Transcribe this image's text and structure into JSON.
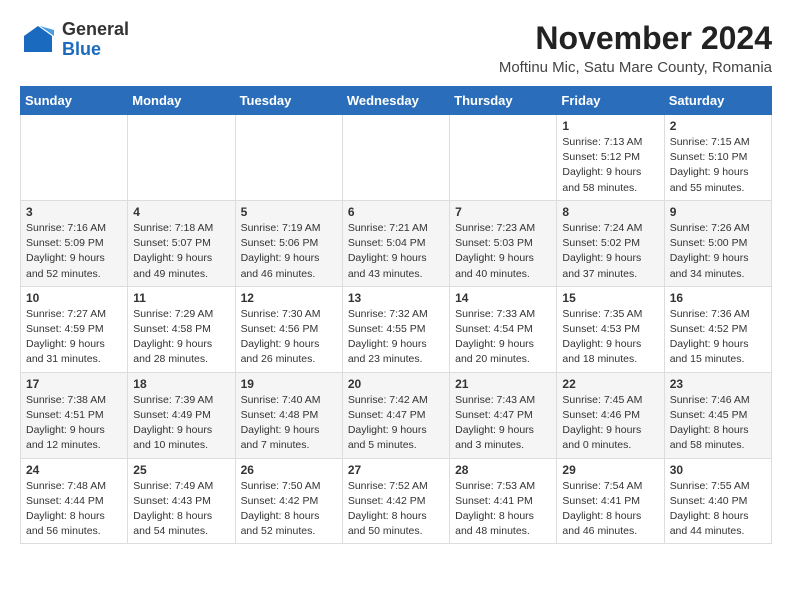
{
  "logo": {
    "general": "General",
    "blue": "Blue"
  },
  "header": {
    "month": "November 2024",
    "location": "Moftinu Mic, Satu Mare County, Romania"
  },
  "weekdays": [
    "Sunday",
    "Monday",
    "Tuesday",
    "Wednesday",
    "Thursday",
    "Friday",
    "Saturday"
  ],
  "weeks": [
    [
      {
        "day": "",
        "info": ""
      },
      {
        "day": "",
        "info": ""
      },
      {
        "day": "",
        "info": ""
      },
      {
        "day": "",
        "info": ""
      },
      {
        "day": "",
        "info": ""
      },
      {
        "day": "1",
        "info": "Sunrise: 7:13 AM\nSunset: 5:12 PM\nDaylight: 9 hours and 58 minutes."
      },
      {
        "day": "2",
        "info": "Sunrise: 7:15 AM\nSunset: 5:10 PM\nDaylight: 9 hours and 55 minutes."
      }
    ],
    [
      {
        "day": "3",
        "info": "Sunrise: 7:16 AM\nSunset: 5:09 PM\nDaylight: 9 hours and 52 minutes."
      },
      {
        "day": "4",
        "info": "Sunrise: 7:18 AM\nSunset: 5:07 PM\nDaylight: 9 hours and 49 minutes."
      },
      {
        "day": "5",
        "info": "Sunrise: 7:19 AM\nSunset: 5:06 PM\nDaylight: 9 hours and 46 minutes."
      },
      {
        "day": "6",
        "info": "Sunrise: 7:21 AM\nSunset: 5:04 PM\nDaylight: 9 hours and 43 minutes."
      },
      {
        "day": "7",
        "info": "Sunrise: 7:23 AM\nSunset: 5:03 PM\nDaylight: 9 hours and 40 minutes."
      },
      {
        "day": "8",
        "info": "Sunrise: 7:24 AM\nSunset: 5:02 PM\nDaylight: 9 hours and 37 minutes."
      },
      {
        "day": "9",
        "info": "Sunrise: 7:26 AM\nSunset: 5:00 PM\nDaylight: 9 hours and 34 minutes."
      }
    ],
    [
      {
        "day": "10",
        "info": "Sunrise: 7:27 AM\nSunset: 4:59 PM\nDaylight: 9 hours and 31 minutes."
      },
      {
        "day": "11",
        "info": "Sunrise: 7:29 AM\nSunset: 4:58 PM\nDaylight: 9 hours and 28 minutes."
      },
      {
        "day": "12",
        "info": "Sunrise: 7:30 AM\nSunset: 4:56 PM\nDaylight: 9 hours and 26 minutes."
      },
      {
        "day": "13",
        "info": "Sunrise: 7:32 AM\nSunset: 4:55 PM\nDaylight: 9 hours and 23 minutes."
      },
      {
        "day": "14",
        "info": "Sunrise: 7:33 AM\nSunset: 4:54 PM\nDaylight: 9 hours and 20 minutes."
      },
      {
        "day": "15",
        "info": "Sunrise: 7:35 AM\nSunset: 4:53 PM\nDaylight: 9 hours and 18 minutes."
      },
      {
        "day": "16",
        "info": "Sunrise: 7:36 AM\nSunset: 4:52 PM\nDaylight: 9 hours and 15 minutes."
      }
    ],
    [
      {
        "day": "17",
        "info": "Sunrise: 7:38 AM\nSunset: 4:51 PM\nDaylight: 9 hours and 12 minutes."
      },
      {
        "day": "18",
        "info": "Sunrise: 7:39 AM\nSunset: 4:49 PM\nDaylight: 9 hours and 10 minutes."
      },
      {
        "day": "19",
        "info": "Sunrise: 7:40 AM\nSunset: 4:48 PM\nDaylight: 9 hours and 7 minutes."
      },
      {
        "day": "20",
        "info": "Sunrise: 7:42 AM\nSunset: 4:47 PM\nDaylight: 9 hours and 5 minutes."
      },
      {
        "day": "21",
        "info": "Sunrise: 7:43 AM\nSunset: 4:47 PM\nDaylight: 9 hours and 3 minutes."
      },
      {
        "day": "22",
        "info": "Sunrise: 7:45 AM\nSunset: 4:46 PM\nDaylight: 9 hours and 0 minutes."
      },
      {
        "day": "23",
        "info": "Sunrise: 7:46 AM\nSunset: 4:45 PM\nDaylight: 8 hours and 58 minutes."
      }
    ],
    [
      {
        "day": "24",
        "info": "Sunrise: 7:48 AM\nSunset: 4:44 PM\nDaylight: 8 hours and 56 minutes."
      },
      {
        "day": "25",
        "info": "Sunrise: 7:49 AM\nSunset: 4:43 PM\nDaylight: 8 hours and 54 minutes."
      },
      {
        "day": "26",
        "info": "Sunrise: 7:50 AM\nSunset: 4:42 PM\nDaylight: 8 hours and 52 minutes."
      },
      {
        "day": "27",
        "info": "Sunrise: 7:52 AM\nSunset: 4:42 PM\nDaylight: 8 hours and 50 minutes."
      },
      {
        "day": "28",
        "info": "Sunrise: 7:53 AM\nSunset: 4:41 PM\nDaylight: 8 hours and 48 minutes."
      },
      {
        "day": "29",
        "info": "Sunrise: 7:54 AM\nSunset: 4:41 PM\nDaylight: 8 hours and 46 minutes."
      },
      {
        "day": "30",
        "info": "Sunrise: 7:55 AM\nSunset: 4:40 PM\nDaylight: 8 hours and 44 minutes."
      }
    ]
  ]
}
